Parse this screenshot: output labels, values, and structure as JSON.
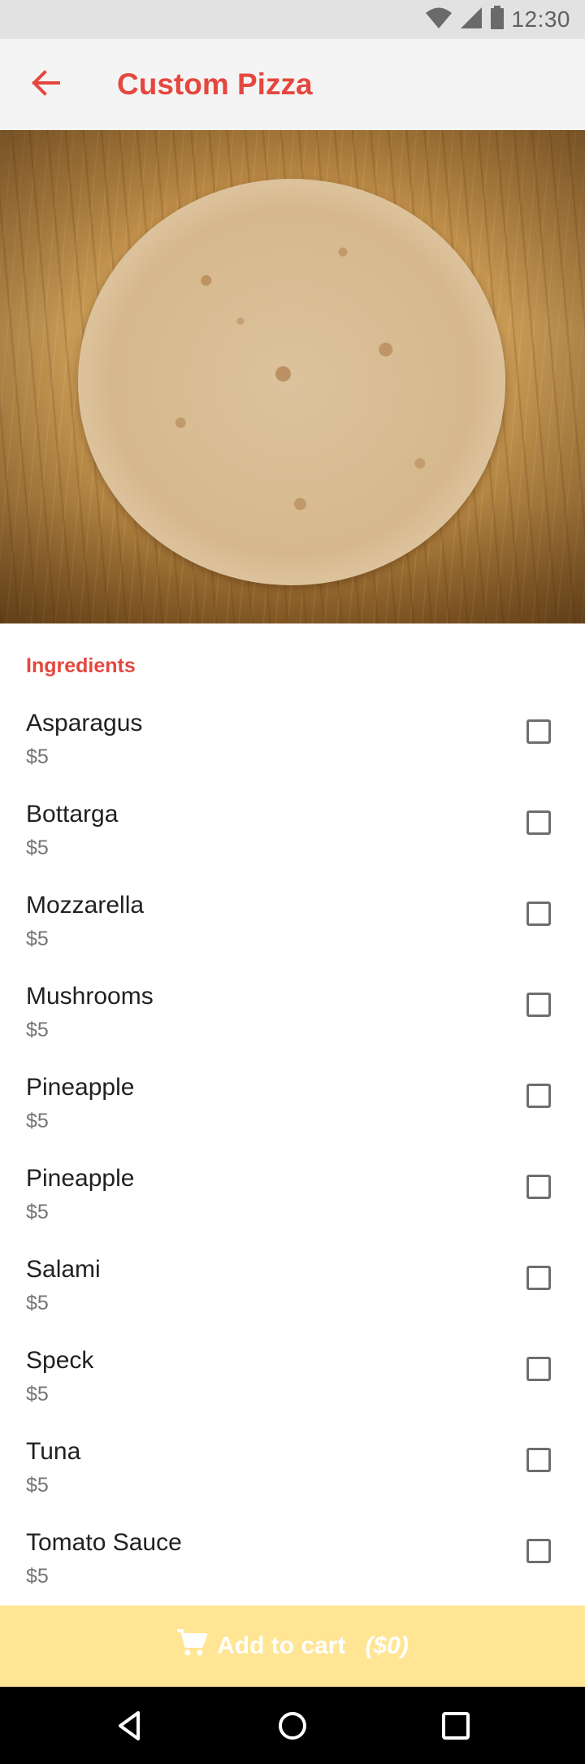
{
  "status_bar": {
    "time": "12:30",
    "icons": [
      "wifi-icon",
      "signal-icon",
      "battery-icon"
    ]
  },
  "app_bar": {
    "title": "Custom Pizza",
    "back_icon": "arrow-back-icon"
  },
  "colors": {
    "accent": "#e5473e",
    "cart_bar": "#ffe594",
    "status_bar": "#e2e2e2",
    "app_bar": "#f4f4f4"
  },
  "ingredients": {
    "header": "Ingredients",
    "items": [
      {
        "name": "Asparagus",
        "price": "$5",
        "checked": false
      },
      {
        "name": "Bottarga",
        "price": "$5",
        "checked": false
      },
      {
        "name": "Mozzarella",
        "price": "$5",
        "checked": false
      },
      {
        "name": "Mushrooms",
        "price": "$5",
        "checked": false
      },
      {
        "name": "Pineapple",
        "price": "$5",
        "checked": false
      },
      {
        "name": "Pineapple",
        "price": "$5",
        "checked": false
      },
      {
        "name": "Salami",
        "price": "$5",
        "checked": false
      },
      {
        "name": "Speck",
        "price": "$5",
        "checked": false
      },
      {
        "name": "Tuna",
        "price": "$5",
        "checked": false
      },
      {
        "name": "Tomato Sauce",
        "price": "$5",
        "checked": false
      }
    ]
  },
  "cart": {
    "label": "Add to cart",
    "total": "($0)",
    "icon": "shopping-cart-icon"
  },
  "nav_bar": {
    "icons": [
      "back-triangle-icon",
      "home-circle-icon",
      "recents-square-icon"
    ]
  }
}
